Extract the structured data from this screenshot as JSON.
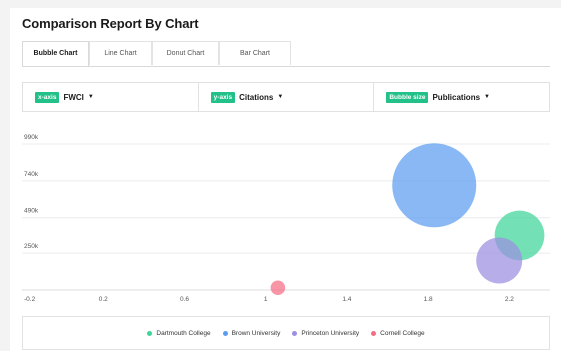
{
  "title": "Comparison Report By Chart",
  "tabs": [
    {
      "label": "Bubble Chart",
      "active": true
    },
    {
      "label": "Line Chart",
      "active": false
    },
    {
      "label": "Donut Chart",
      "active": false
    },
    {
      "label": "Bar Chart",
      "active": false
    }
  ],
  "selectors": {
    "x": {
      "badge": "x-axis",
      "value": "FWCI"
    },
    "y": {
      "badge": "y-axis",
      "value": "Citations"
    },
    "size": {
      "badge": "Bubble size",
      "value": "Publications"
    }
  },
  "colors": {
    "accent": "#22c189",
    "dartmouth": "#3dd598",
    "brown": "#5b9cf0",
    "princeton": "#9b8fe0",
    "cornell": "#f56c84"
  },
  "chart_data": {
    "type": "scatter",
    "xlim": [
      -0.2,
      2.4
    ],
    "ylim": [
      0,
      990000
    ],
    "x_ticks": [
      "-0.2",
      "0.2",
      "0.6",
      "1",
      "1.4",
      "1.8",
      "2.2"
    ],
    "x_tick_values": [
      -0.2,
      0.2,
      0.6,
      1.0,
      1.4,
      1.8,
      2.2
    ],
    "y_ticks": [
      "250k",
      "490k",
      "740k",
      "990k"
    ],
    "y_tick_values": [
      250000,
      490000,
      740000,
      990000
    ],
    "grid": true,
    "legend_position": "bottom",
    "series": [
      {
        "name": "Dartmouth College",
        "color": "#3dd598",
        "x": 2.25,
        "y": 370000,
        "size": 35
      },
      {
        "name": "Brown University",
        "color": "#5b9cf0",
        "x": 1.83,
        "y": 710000,
        "size": 100
      },
      {
        "name": "Princeton University",
        "color": "#9b8fe0",
        "x": 2.15,
        "y": 200000,
        "size": 30
      },
      {
        "name": "Cornell College",
        "color": "#f56c84",
        "x": 1.06,
        "y": 15000,
        "size": 3
      }
    ]
  }
}
